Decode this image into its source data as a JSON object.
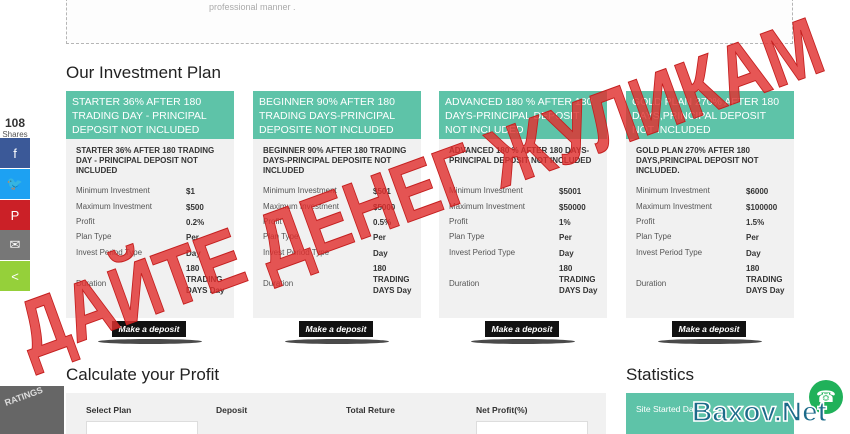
{
  "top_box_text": "professional manner .",
  "investment_title": "Our Investment Plan",
  "plans": [
    {
      "header": "STARTER 36% AFTER 180 TRADING DAY - PRINCIPAL DEPOSIT NOT INCLUDED",
      "subtitle": "STARTER 36% AFTER 180 TRADING DAY - PRINCIPAL DEPOSIT NOT INCLUDED",
      "rows": [
        {
          "label": "Minimum Investment",
          "value": "$1"
        },
        {
          "label": "Maximum Investment",
          "value": "$500"
        },
        {
          "label": "Profit",
          "value": "0.2%"
        },
        {
          "label": "Plan Type",
          "value": "Per"
        },
        {
          "label": "Invest Period Type",
          "value": "Day"
        },
        {
          "label": "Duration",
          "value": "180 TRADING DAYS Day"
        }
      ],
      "button": "Make a deposit"
    },
    {
      "header": "BEGINNER 90% AFTER 180 TRADING DAYS-PRINCIPAL DEPOSITE NOT INCLUDED",
      "subtitle": "BEGINNER 90% AFTER 180 TRADING DAYS-PRINCIPAL DEPOSITE NOT INCLUDED",
      "rows": [
        {
          "label": "Minimum Investment",
          "value": "$501"
        },
        {
          "label": "Maximum Investment",
          "value": "$5000"
        },
        {
          "label": "Profit",
          "value": "0.5%"
        },
        {
          "label": "Plan Type",
          "value": "Per"
        },
        {
          "label": "Invest Period Type",
          "value": "Day"
        },
        {
          "label": "Duration",
          "value": "180 TRADING DAYS Day"
        }
      ],
      "button": "Make a deposit"
    },
    {
      "header": "ADVANCED 180 % AFTER 180 DAYS-PRINCIPAL DEPOSIT NOT INCLUDED",
      "subtitle": "ADVANCED 180 % AFTER 180 DAYS-PRINCIPAL DEPOSIT NOT INCLUDED",
      "rows": [
        {
          "label": "Minimum Investment",
          "value": "$5001"
        },
        {
          "label": "Maximum Investment",
          "value": "$50000"
        },
        {
          "label": "Profit",
          "value": "1%"
        },
        {
          "label": "Plan Type",
          "value": "Per"
        },
        {
          "label": "Invest Period Type",
          "value": "Day"
        },
        {
          "label": "Duration",
          "value": "180 TRADING DAYS Day"
        }
      ],
      "button": "Make a deposit"
    },
    {
      "header": "GOLD PLAN 270% AFTER 180 DAYS,PRINCIPAL DEPOSIT NOT INCLUDED",
      "subtitle": "GOLD PLAN 270% AFTER 180 DAYS,PRINCIPAL DEPOSIT NOT INCLUDED.",
      "rows": [
        {
          "label": "Minimum Investment",
          "value": "$6000"
        },
        {
          "label": "Maximum Investment",
          "value": "$100000"
        },
        {
          "label": "Profit",
          "value": "1.5%"
        },
        {
          "label": "Plan Type",
          "value": "Per"
        },
        {
          "label": "Invest Period Type",
          "value": "Day"
        },
        {
          "label": "Duration",
          "value": "180 TRADING DAYS Day"
        }
      ],
      "button": "Make a deposit"
    }
  ],
  "share": {
    "count": "108",
    "label": "Shares",
    "buttons": [
      {
        "icon": "facebook-icon",
        "glyph": "f",
        "color": "#3b5998"
      },
      {
        "icon": "twitter-icon",
        "glyph": "🐦",
        "color": "#1da1f2"
      },
      {
        "icon": "pinterest-icon",
        "glyph": "P",
        "color": "#cb2027"
      },
      {
        "icon": "email-icon",
        "glyph": "✉",
        "color": "#777777"
      },
      {
        "icon": "sharethis-icon",
        "glyph": "<",
        "color": "#95d03a"
      }
    ]
  },
  "calculator": {
    "title": "Calculate your Profit",
    "columns": [
      "Select Plan",
      "Deposit",
      "Total Reture",
      "Net Profit(%)"
    ]
  },
  "statistics": {
    "title": "Statistics",
    "first_row": "Site Started Dat"
  },
  "overlay": {
    "stamp_text": "ДАЙТЕ ДЕНЕГ ЖУЛИКАМ",
    "stamp_color": "#e0312f",
    "watermark": "Baxov.Net",
    "badge_text": "RATINGS"
  },
  "colors": {
    "accent": "#5ec3a8",
    "card_bg": "#f1f1f1"
  }
}
